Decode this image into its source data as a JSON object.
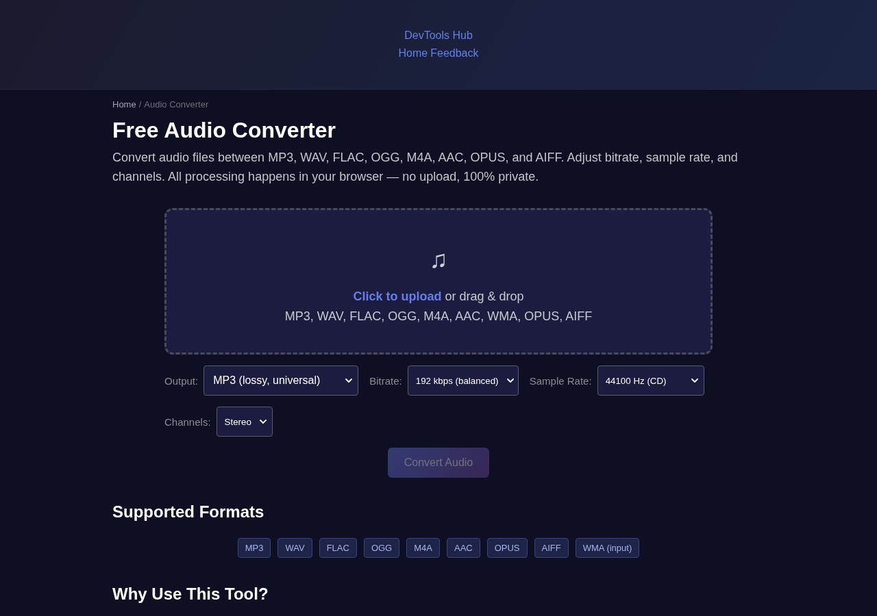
{
  "header": {
    "site_title": "DevTools Hub",
    "nav": [
      "Home",
      "Feedback"
    ]
  },
  "breadcrumb": {
    "items": [
      "Home",
      "Audio Converter"
    ],
    "separator": "/"
  },
  "title": "Free Audio Converter",
  "description": "Convert audio files between MP3, WAV, FLAC, OGG, M4A, AAC, OPUS, and AIFF. Adjust bitrate, sample rate, and channels. All processing happens in your browser — no upload, 100% private.",
  "upload": {
    "icon": "♫",
    "link": "Click to upload",
    "text": "or drag & drop",
    "formats": "MP3, WAV, FLAC, OGG, M4A, AAC, WMA, OPUS, AIFF"
  },
  "options": [
    {
      "label": "Output:",
      "value": "MP3 (lossy, universal)"
    },
    {
      "label": "Bitrate:",
      "value": "192 kbps (balanced)"
    },
    {
      "label": "Sample Rate:",
      "value": "44100 Hz (CD)"
    },
    {
      "label": "Channels:",
      "value": "Stereo"
    }
  ],
  "convert_button": {
    "label": "Convert Audio",
    "disabled": true
  },
  "sections": [
    {
      "title": "Supported Formats",
      "tags": [
        "MP3",
        "WAV",
        "FLAC",
        "OGG",
        "M4A",
        "AAC",
        "OPUS",
        "AIFF",
        "WMA (input)"
      ]
    },
    {
      "title": "Why Use This Tool?"
    }
  ]
}
